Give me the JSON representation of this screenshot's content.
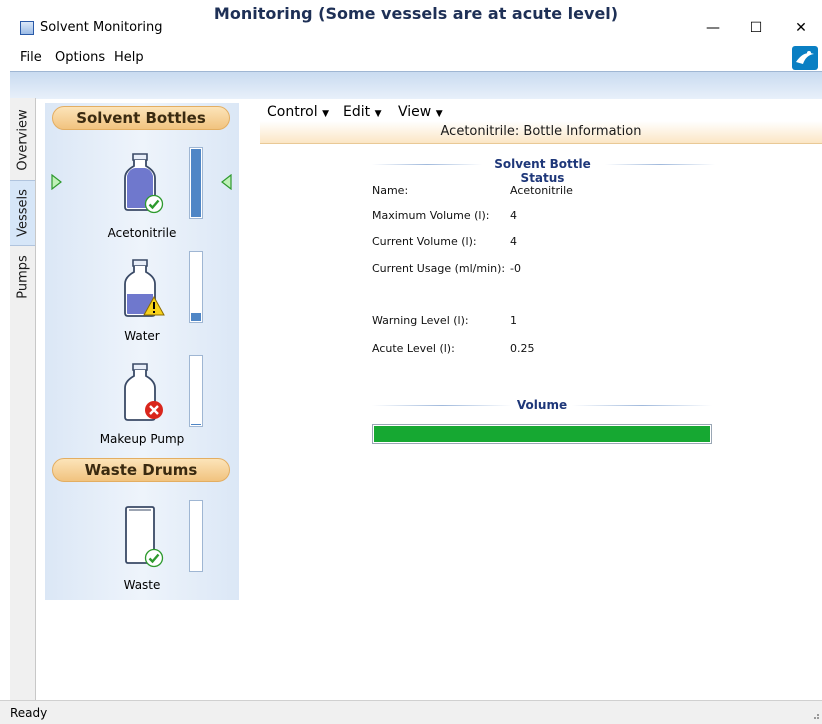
{
  "window": {
    "title": "Solvent Monitoring",
    "controls": {
      "minimize": "—",
      "maximize": "☐",
      "close": "✕"
    }
  },
  "menubar": [
    "File",
    "Options",
    "Help"
  ],
  "header": "Monitoring (Some vessels are at acute level)",
  "side_tabs": [
    "Overview",
    "Vessels",
    "Pumps"
  ],
  "panel": {
    "solvent_title": "Solvent Bottles",
    "waste_title": "Waste Drums",
    "vessels": [
      {
        "label": "Acetonitrile",
        "status": "ok",
        "level_fraction": 1.0
      },
      {
        "label": "Water",
        "status": "warning",
        "level_fraction": 0.12
      },
      {
        "label": "Makeup Pump",
        "status": "error",
        "level_fraction": 0.02
      }
    ],
    "waste": [
      {
        "label": "Waste",
        "status": "ok",
        "level_fraction": 0.0
      }
    ]
  },
  "toolbar": {
    "control": "Control",
    "edit": "Edit",
    "view": "View"
  },
  "subheader": "Acetonitrile: Bottle Information",
  "status_section": {
    "title": "Solvent Bottle Status",
    "rows": [
      {
        "label": "Name:",
        "value": "Acetonitrile"
      },
      {
        "label": "Maximum Volume (l):",
        "value": "4"
      },
      {
        "label": "Current Volume (l):",
        "value": "4"
      },
      {
        "label": "Current Usage (ml/min):",
        "value": "-0"
      },
      {
        "label": "Warning Level (l):",
        "value": "1"
      },
      {
        "label": "Acute Level (l):",
        "value": "0.25"
      }
    ]
  },
  "volume": {
    "title": "Volume",
    "fraction": 1.0,
    "color": "#16a832"
  },
  "statusbar": "Ready"
}
